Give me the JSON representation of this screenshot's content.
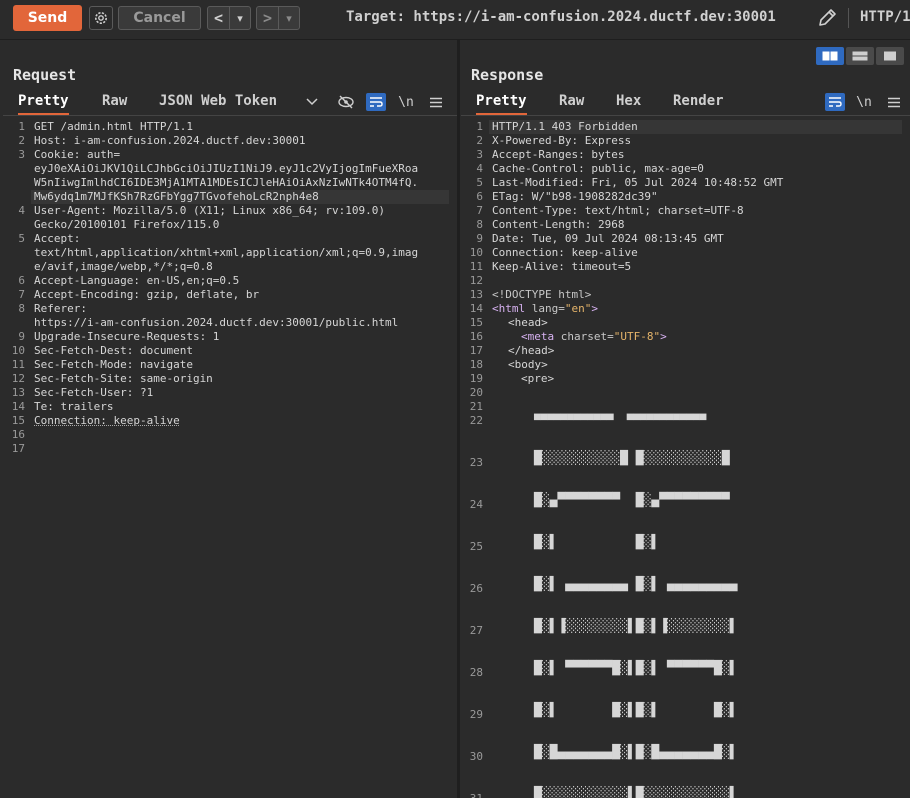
{
  "toolbar": {
    "send_label": "Send",
    "cancel_label": "Cancel",
    "back_label": "<",
    "back_menu_label": "▾",
    "forward_label": ">",
    "forward_menu_label": "▾",
    "target": "Target: https://i-am-confusion.2024.ductf.dev:30001",
    "protocol": "HTTP/1"
  },
  "request": {
    "title": "Request",
    "tabs": [
      "Pretty",
      "Raw",
      "JSON Web Token"
    ],
    "newline_label": "\\n",
    "lines": [
      {
        "n": "1",
        "text": "GET /admin.html HTTP/1.1"
      },
      {
        "n": "2",
        "text": "Host: i-am-confusion.2024.ductf.dev:30001"
      },
      {
        "n": "3",
        "text": "Cookie: auth=",
        "cont": [
          "eyJ0eXAiOiJKV1QiLCJhbGciOiJIUzI1NiJ9.eyJ1c2VyIjogImFueXRoa",
          "W5nIiwgImlhdCI6IDE3MjA1MTA1MDEsICJleHAiOiAxNzIwNTk4OTM4fQ.",
          "Mw6ydq1m7MJfKSh7RzGFbYgg7TGvofehoLcR2nph4e8"
        ]
      },
      {
        "n": "4",
        "text": "User-Agent: Mozilla/5.0 (X11; Linux x86_64; rv:109.0)",
        "cont": [
          "Gecko/20100101 Firefox/115.0"
        ]
      },
      {
        "n": "5",
        "text": "Accept:",
        "cont": [
          "text/html,application/xhtml+xml,application/xml;q=0.9,imag",
          "e/avif,image/webp,*/*;q=0.8"
        ]
      },
      {
        "n": "6",
        "text": "Accept-Language: en-US,en;q=0.5"
      },
      {
        "n": "7",
        "text": "Accept-Encoding: gzip, deflate, br"
      },
      {
        "n": "8",
        "text": "Referer:",
        "cont": [
          "https://i-am-confusion.2024.ductf.dev:30001/public.html"
        ]
      },
      {
        "n": "9",
        "text": "Upgrade-Insecure-Requests: 1"
      },
      {
        "n": "10",
        "text": "Sec-Fetch-Dest: document"
      },
      {
        "n": "11",
        "text": "Sec-Fetch-Mode: navigate"
      },
      {
        "n": "12",
        "text": "Sec-Fetch-Site: same-origin"
      },
      {
        "n": "13",
        "text": "Sec-Fetch-User: ?1"
      },
      {
        "n": "14",
        "text": "Te: trailers"
      },
      {
        "n": "15",
        "text": "Connection: keep-alive"
      },
      {
        "n": "16",
        "text": ""
      },
      {
        "n": "17",
        "text": ""
      }
    ]
  },
  "response": {
    "title": "Response",
    "tabs": [
      "Pretty",
      "Raw",
      "Hex",
      "Render"
    ],
    "newline_label": "\\n",
    "lines": [
      "HTTP/1.1 403 Forbidden",
      "X-Powered-By: Express",
      "Accept-Ranges: bytes",
      "Cache-Control: public, max-age=0",
      "Last-Modified: Fri, 05 Jul 2024 10:48:52 GMT",
      "ETag: W/\"b98-1908282dc39\"",
      "Content-Type: text/html; charset=UTF-8",
      "Content-Length: 2968",
      "Date: Tue, 09 Jul 2024 08:13:45 GMT",
      "Connection: keep-alive",
      "Keep-Alive: timeout=5",
      "",
      "<!DOCTYPE html>"
    ],
    "html_lines": {
      "l14_open": "<html",
      "l14_attr": " lang=",
      "l14_val": "\"en\"",
      "l14_close": ">",
      "l15": "<head>",
      "l16_open": "<meta",
      "l16_attr": " charset=",
      "l16_val": "\"UTF-8\"",
      "l16_close": ">",
      "l17": "</head>",
      "l18": "<body>",
      "l19": "<pre>"
    },
    "ascii_lines": [
      {
        "n": "22",
        "text": "▀▀▀▀▀▀▀▀▀▀▀▀  ▀▀▀▀▀▀▀▀▀▀▀▀"
      },
      {
        "n": "23",
        "text": "█░░░░░░░░░░█ █░░░░░░░░░░█"
      },
      {
        "n": "24",
        "text": "█░▄▀▀▀▀▀▀▀▀  █░▄▀▀▀▀▀▀▀▀▀"
      },
      {
        "n": "25",
        "text": "█░▌          █░▌"
      },
      {
        "n": "26",
        "text": "█░▌ ▄▄▄▄▄▄▄▄ █░▌ ▄▄▄▄▄▄▄▄▄"
      },
      {
        "n": "27",
        "text": "█░▌▐░░░░░░░░▌█░▌▐░░░░░░░░▌"
      },
      {
        "n": "28",
        "text": "█░▌ ▀▀▀▀▀▀█░▌█░▌ ▀▀▀▀▀▀█░▌"
      },
      {
        "n": "29",
        "text": "█░▌       █░▌█░▌       █░▌"
      },
      {
        "n": "30",
        "text": "█░█▄▄▄▄▄▄▄█░▌█░█▄▄▄▄▄▄▄█░▌"
      },
      {
        "n": "31",
        "text": "█░░░░░░░░░░░▌█░░░░░░░░░░░▌"
      }
    ]
  }
}
